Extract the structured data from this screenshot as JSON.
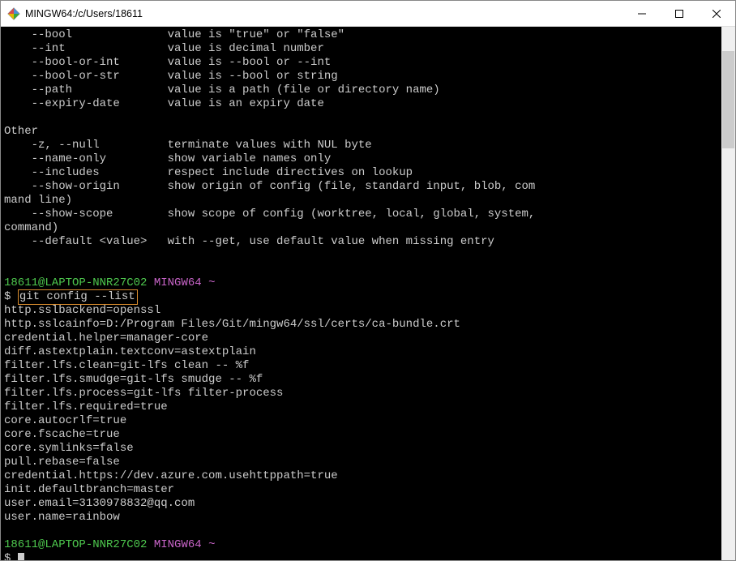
{
  "window": {
    "title": "MINGW64:/c/Users/18611"
  },
  "terminal": {
    "help_lines": [
      "    --bool              value is \"true\" or \"false\"",
      "    --int               value is decimal number",
      "    --bool-or-int       value is --bool or --int",
      "    --bool-or-str       value is --bool or string",
      "    --path              value is a path (file or directory name)",
      "    --expiry-date       value is an expiry date",
      "",
      "Other",
      "    -z, --null          terminate values with NUL byte",
      "    --name-only         show variable names only",
      "    --includes          respect include directives on lookup",
      "    --show-origin       show origin of config (file, standard input, blob, com",
      "mand line)",
      "    --show-scope        show scope of config (worktree, local, global, system, ",
      "command)",
      "    --default <value>   with --get, use default value when missing entry",
      "",
      ""
    ],
    "prompt1": {
      "user": "18611@LAPTOP-NNR27C02",
      "mingw": "MINGW64",
      "tilde": "~"
    },
    "command1": {
      "dollar": "$",
      "cmd": "git config --list"
    },
    "config_output": [
      "http.sslbackend=openssl",
      "http.sslcainfo=D:/Program Files/Git/mingw64/ssl/certs/ca-bundle.crt",
      "credential.helper=manager-core",
      "diff.astextplain.textconv=astextplain",
      "filter.lfs.clean=git-lfs clean -- %f",
      "filter.lfs.smudge=git-lfs smudge -- %f",
      "filter.lfs.process=git-lfs filter-process",
      "filter.lfs.required=true",
      "core.autocrlf=true",
      "core.fscache=true",
      "core.symlinks=false",
      "pull.rebase=false",
      "credential.https://dev.azure.com.usehttppath=true",
      "init.defaultbranch=master",
      "user.email=3130978832@qq.com",
      "user.name=rainbow",
      ""
    ],
    "prompt2": {
      "user": "18611@LAPTOP-NNR27C02",
      "mingw": "MINGW64",
      "tilde": "~"
    },
    "command2": {
      "dollar": "$"
    }
  }
}
